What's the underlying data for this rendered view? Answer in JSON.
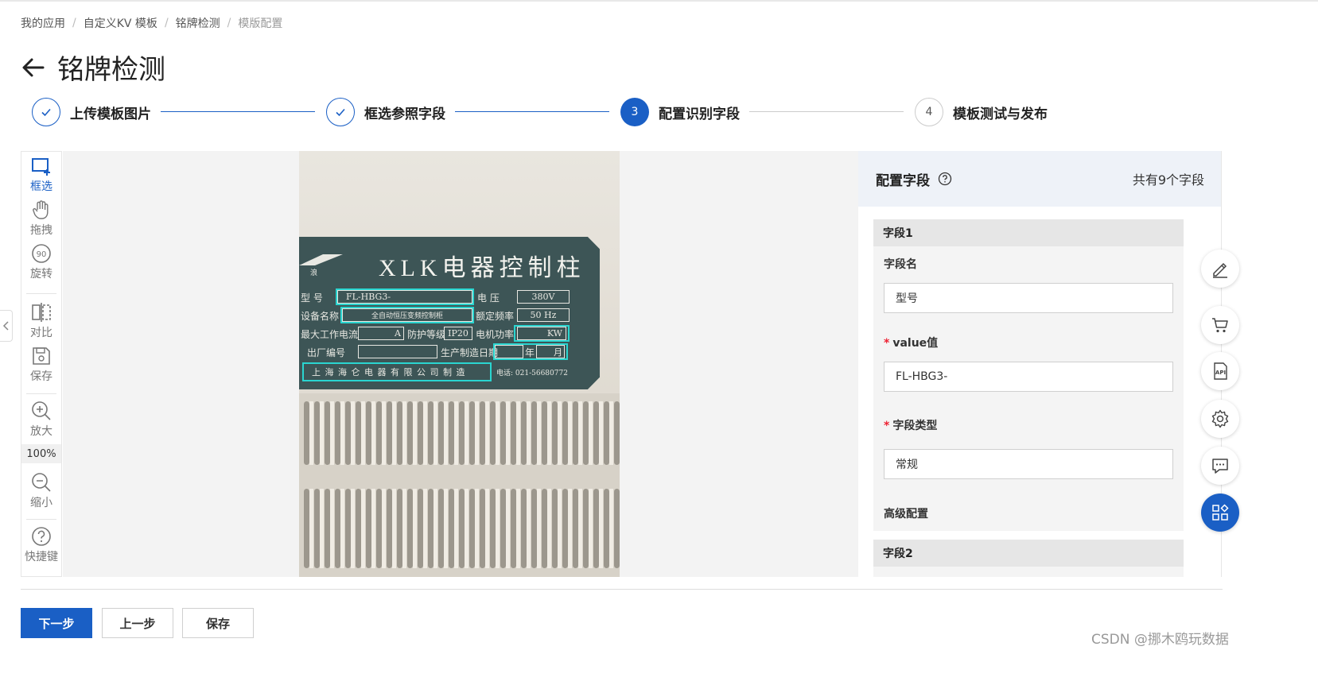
{
  "breadcrumb": {
    "items": [
      "我的应用",
      "自定义KV 模板",
      "铭牌检测",
      "模版配置"
    ],
    "separator": "/"
  },
  "page": {
    "title": "铭牌检测"
  },
  "steps": [
    {
      "number": "1",
      "label": "上传模板图片",
      "state": "done"
    },
    {
      "number": "2",
      "label": "框选参照字段",
      "state": "done"
    },
    {
      "number": "3",
      "label": "配置识别字段",
      "state": "active"
    },
    {
      "number": "4",
      "label": "模板测试与发布",
      "state": "todo"
    }
  ],
  "toolbar": {
    "select": "框选",
    "drag": "拖拽",
    "rotate": "旋转",
    "compare": "对比",
    "save": "保存",
    "zoom_in": "放大",
    "zoom_level": "100%",
    "zoom_out": "缩小",
    "shortcuts": "快捷键"
  },
  "nameplate": {
    "title": "XLK电器控制柱",
    "logo_text": "浪",
    "rows": {
      "model_label": "型 号",
      "model_value": "FL-HBG3-",
      "voltage_label": "电 压",
      "voltage_value": "380V",
      "device_label": "设备名称",
      "device_value": "全自动恒压变频控制柜",
      "freq_label": "额定频率",
      "freq_value": "50 Hz",
      "current_label": "最大工作电流",
      "current_unit": "A",
      "protect_label": "防护等级",
      "protect_value": "IP20",
      "power_label": "电机功率",
      "power_unit": "KW",
      "serial_label": "出厂编号",
      "date_label": "生产制造日期",
      "year": "年",
      "month": "月",
      "maker": "上 海 海 仑 电 器 有 限 公 司 制 造",
      "phone": "电话: 021-56680772"
    }
  },
  "panel": {
    "title": "配置字段",
    "count": "共有9个字段",
    "fields": [
      {
        "header": "字段1",
        "name_label": "字段名",
        "name_value": "型号",
        "value_label": "value值",
        "value_value": "FL-HBG3-",
        "type_label": "字段类型",
        "type_value": "常规",
        "advanced_label": "高级配置"
      },
      {
        "header": "字段2"
      }
    ]
  },
  "footer": {
    "next": "下一步",
    "prev": "上一步",
    "save": "保存"
  },
  "watermark": "CSDN @挪木鸥玩数据",
  "colors": {
    "accent": "#1a5fc5",
    "selection": "#2ad5d0",
    "required": "#ee2233"
  }
}
